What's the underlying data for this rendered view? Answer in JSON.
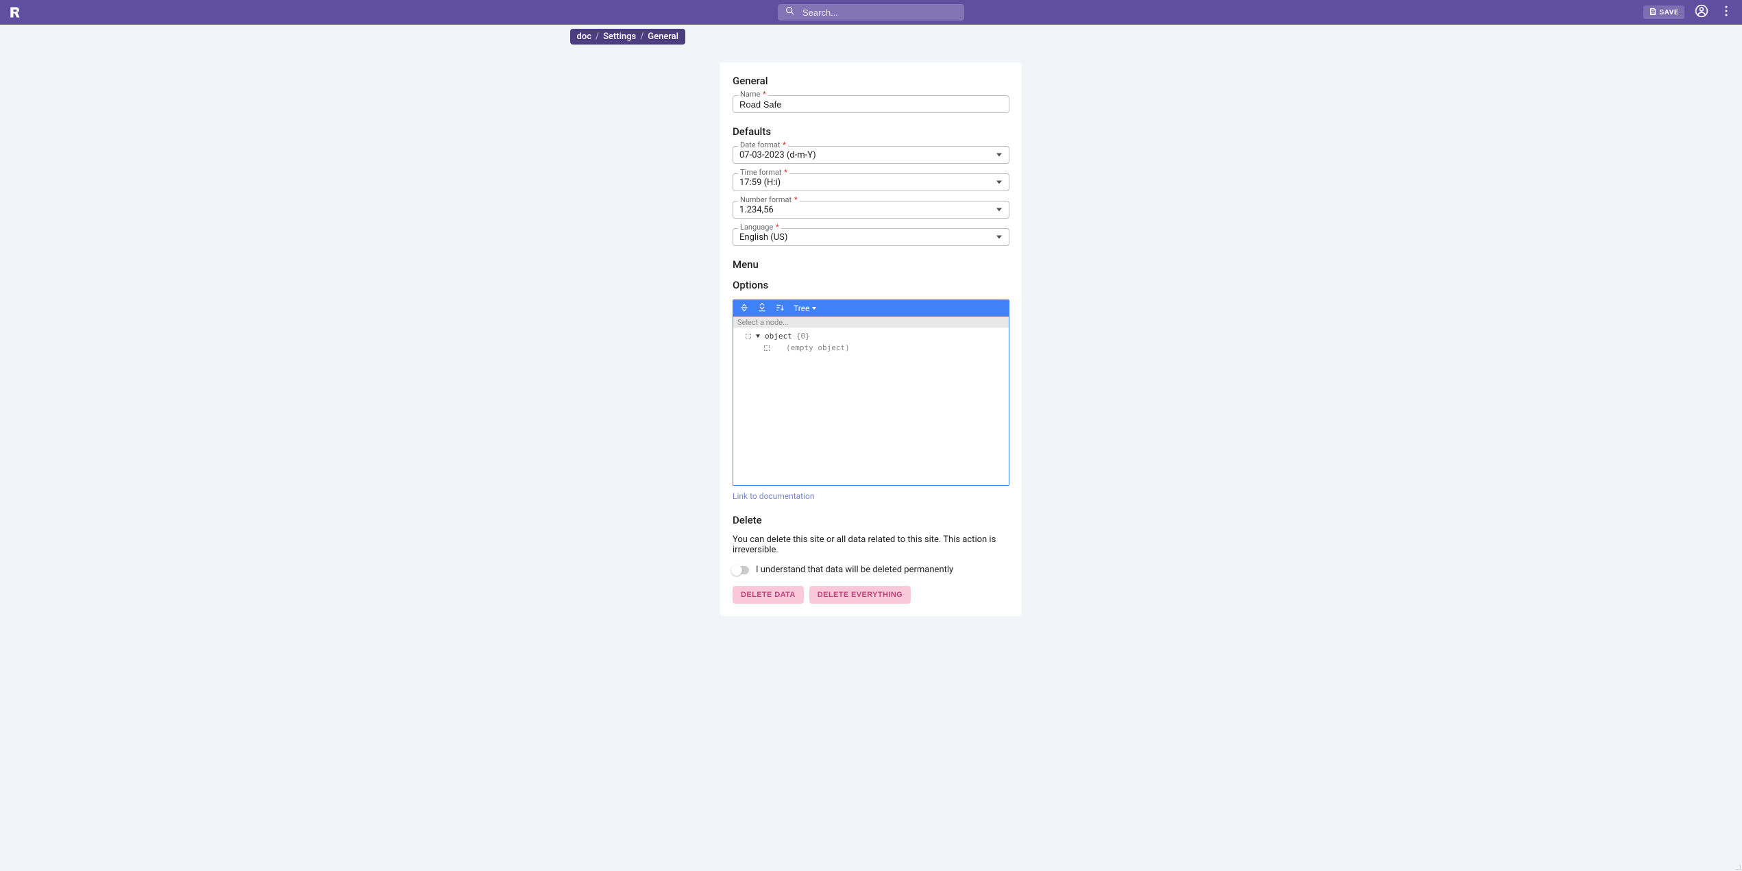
{
  "topbar": {
    "search_placeholder": "Search...",
    "save_label": "SAVE"
  },
  "breadcrumb": {
    "items": [
      "doc",
      "Settings",
      "General"
    ]
  },
  "sections": {
    "general": {
      "title": "General"
    },
    "defaults": {
      "title": "Defaults"
    },
    "menu": {
      "title": "Menu"
    },
    "options": {
      "title": "Options"
    },
    "delete": {
      "title": "Delete"
    }
  },
  "fields": {
    "name": {
      "label": "Name",
      "value": "Road Safe",
      "required": true
    },
    "date_format": {
      "label": "Date format",
      "value": "07-03-2023 (d-m-Y)",
      "required": true
    },
    "time_format": {
      "label": "Time format",
      "value": "17:59 (H:i)",
      "required": true
    },
    "number_format": {
      "label": "Number format",
      "value": "1.234,56",
      "required": true
    },
    "language": {
      "label": "Language",
      "value": "English (US)",
      "required": true
    }
  },
  "json_editor": {
    "mode_label": "Tree",
    "search_placeholder": "Select a node...",
    "root_type": "object",
    "root_count": "{0}",
    "empty_label": "(empty object)"
  },
  "doc_link": "Link to documentation",
  "delete": {
    "description": "You can delete this site or all data related to this site. This action is irreversible.",
    "confirm_label": "I understand that data will be deleted permanently",
    "delete_data_label": "DELETE DATA",
    "delete_everything_label": "DELETE EVERYTHING"
  },
  "req_mark": "*"
}
